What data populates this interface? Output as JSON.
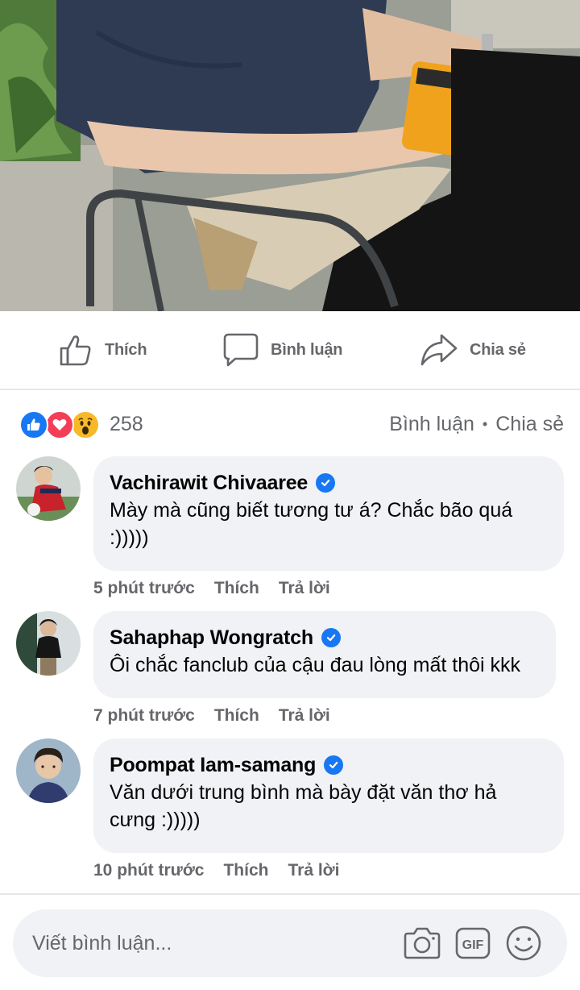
{
  "actions": {
    "like_label": "Thích",
    "comment_label": "Bình luận",
    "share_label": "Chia sẻ"
  },
  "reactions": {
    "count": "258",
    "comments_link": "Bình luận",
    "separator": "•",
    "shares_link": "Chia sẻ",
    "icons": [
      "like-icon",
      "love-icon",
      "wow-icon"
    ],
    "colors": {
      "like": "#1877f2",
      "love": "#f33e58",
      "wow": "#f7b928"
    }
  },
  "comments": [
    {
      "name": "Vachirawit Chivaaree",
      "text": "Mày mà cũng biết tương tư á? Chắc bão quá :)))))",
      "time": "5 phút trước",
      "like": "Thích",
      "reply": "Trả lời"
    },
    {
      "name": "Sahaphap Wongratch",
      "text": "Ôi chắc fanclub của cậu đau lòng mất thôi kkk",
      "time": "7 phút trước",
      "like": "Thích",
      "reply": "Trả lời"
    },
    {
      "name": "Poompat Iam-samang",
      "text": "Văn dưới trung bình mà bày đặt văn thơ hả cưng :)))))",
      "time": "10 phút trước",
      "like": "Thích",
      "reply": "Trả lời"
    }
  ],
  "composer": {
    "placeholder": "Viết bình luận...",
    "gif_label": "GIF"
  },
  "colors": {
    "verified": "#1877f2",
    "secondary_text": "#65676b",
    "bubble": "#f0f2f5"
  }
}
